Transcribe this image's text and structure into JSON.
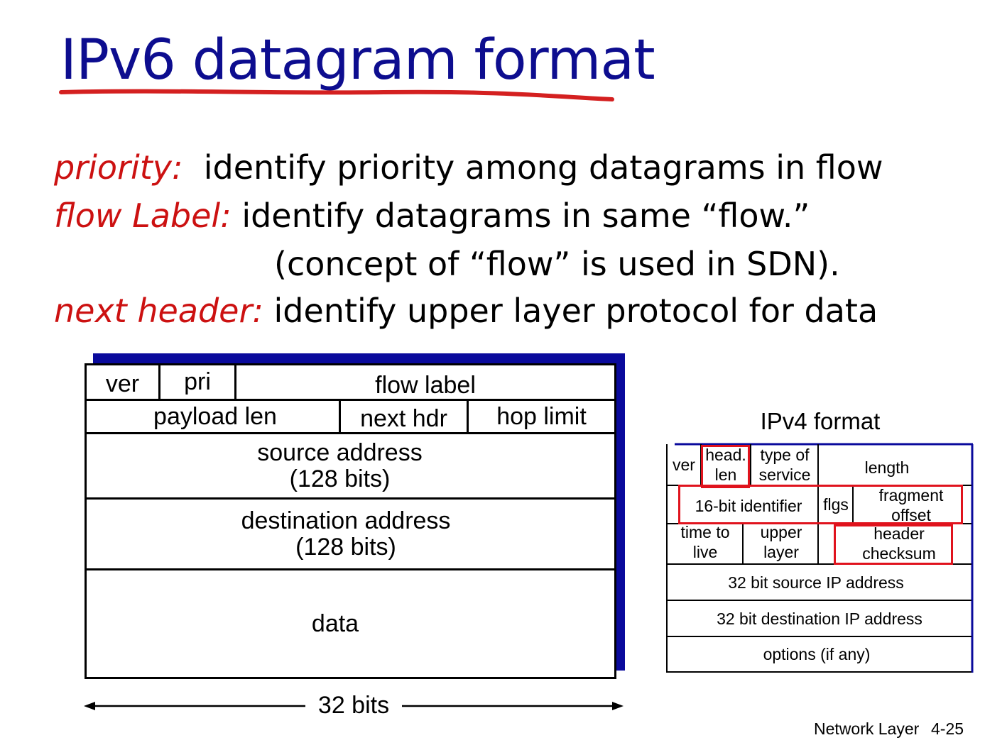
{
  "slide": {
    "title": "IPv6 datagram format",
    "accent_color": "#0d0d8f",
    "term_color": "#cc1111",
    "highlight_color": "#e0131d"
  },
  "definitions": [
    {
      "term": "priority:",
      "text": "identify priority among datagrams in flow"
    },
    {
      "term": "flow Label:",
      "text": "identify datagrams in same “flow.”"
    },
    {
      "term": "",
      "text": "(concept of “flow” is used in SDN)."
    },
    {
      "term": "next header:",
      "text": "identify upper layer protocol for data"
    }
  ],
  "ipv6": {
    "ver": "ver",
    "pri": "pri",
    "flow_label": "flow label",
    "payload_len": "payload len",
    "next_hdr": "next hdr",
    "hop_limit": "hop limit",
    "source_1": "source address",
    "source_2": "(128 bits)",
    "dest_1": "destination address",
    "dest_2": "(128 bits)",
    "data": "data",
    "width_label": "32 bits"
  },
  "ipv4": {
    "title": "IPv4 format",
    "ver": "ver",
    "head_1": "head.",
    "head_2": "len",
    "tos_1": "type of",
    "tos_2": "service",
    "length": "length",
    "identifier": "16-bit identifier",
    "flgs": "flgs",
    "frag_1": "fragment",
    "frag_2": "offset",
    "ttl_1": "time to",
    "ttl_2": "live",
    "upper_1": "upper",
    "upper_2": "layer",
    "checksum_1": "header",
    "checksum_2": "checksum",
    "src": "32 bit source IP address",
    "dst": "32 bit destination IP address",
    "options": "options (if any)"
  },
  "footer": {
    "label": "Network Layer",
    "page": "4-25"
  }
}
